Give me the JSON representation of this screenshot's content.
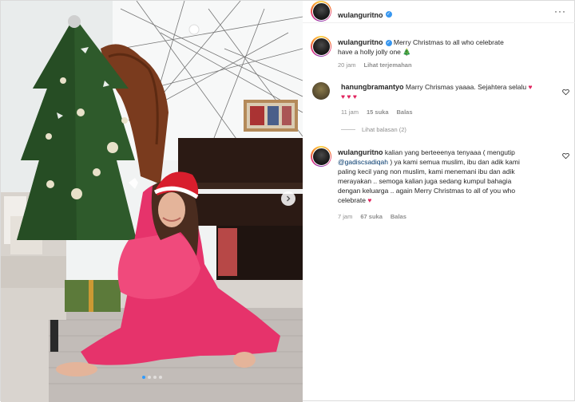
{
  "post": {
    "username": "wulanguritno",
    "verified": true,
    "more_icon": "more-horizontal-icon"
  },
  "photo": {
    "carousel_dots": 4,
    "active_dot": 1,
    "next_icon": "chevron-right-icon"
  },
  "caption": {
    "username": "wulanguritno",
    "line1": "Merry Christmas to all who celebrate",
    "line2": "have a holly jolly one 🎄",
    "time": "20 jam",
    "translate": "Lihat terjemahan"
  },
  "comments": [
    {
      "username": "hanungbramantyo",
      "text_line1": "Marry Chrismas yaaaa. Sejahtera selalu",
      "text_line2_hearts": "♥ ♥ ♥",
      "time": "11 jam",
      "likes": "15 suka",
      "reply": "Balas",
      "view_replies": "Lihat balasan (2)"
    },
    {
      "username": "wulanguritno",
      "lines": [
        "kalian yang berteeenya tenyaaa ( mengutip",
        ") ya kami semua muslim, ibu dan adik kami",
        "paling kecil yang non muslim, kami menemani ibu dan adik",
        "merayakan .. semoga kalian juga sedang kumpul bahagia",
        "dengan keluarga .. again Merry Christmas to all of you who",
        "celebrate"
      ],
      "mention": "@gadiscsadiqah",
      "time": "7 jam",
      "likes": "67 suka",
      "reply": "Balas"
    }
  ]
}
